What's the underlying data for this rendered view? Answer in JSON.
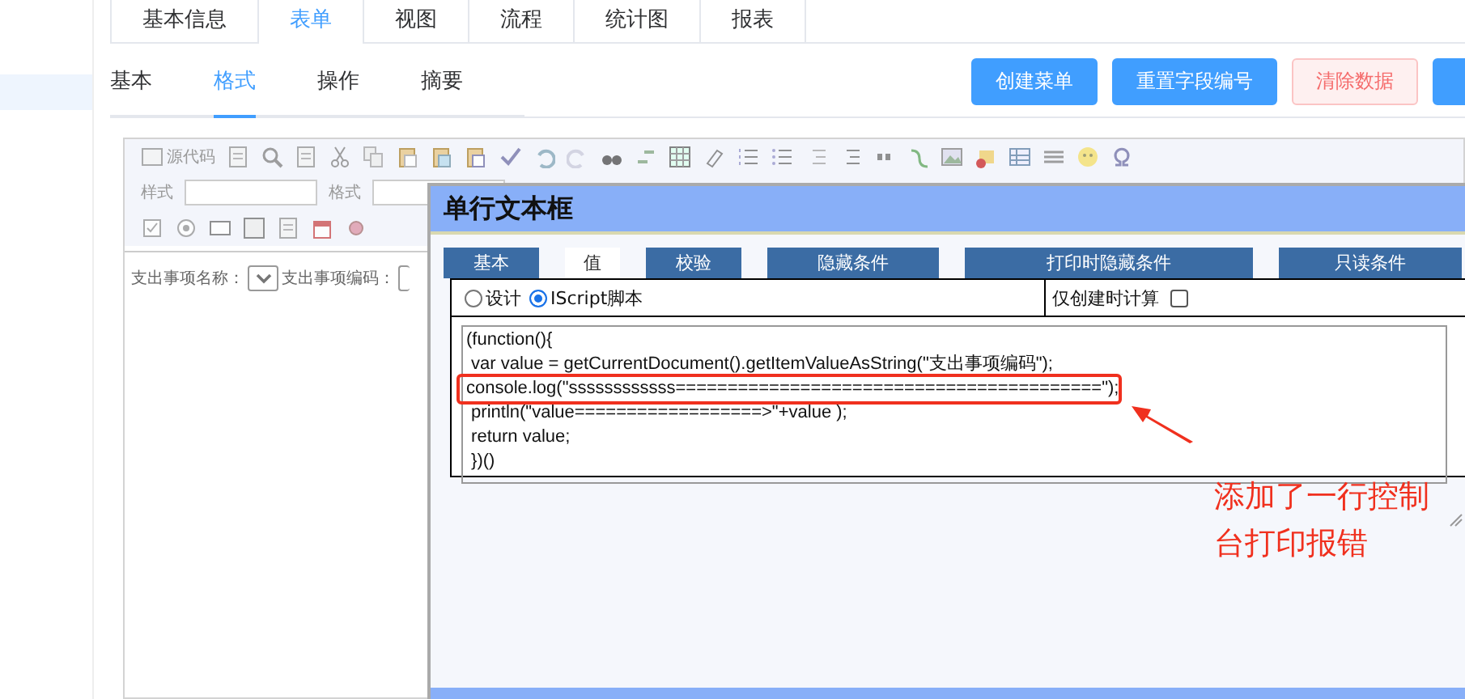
{
  "top_tabs": [
    {
      "label": "基本信息",
      "selected": false
    },
    {
      "label": "表单",
      "selected": true
    },
    {
      "label": "视图",
      "selected": false
    },
    {
      "label": "流程",
      "selected": false
    },
    {
      "label": "统计图",
      "selected": false
    },
    {
      "label": "报表",
      "selected": false
    }
  ],
  "sub_tabs": [
    {
      "label": "基本",
      "selected": false
    },
    {
      "label": "格式",
      "selected": true
    },
    {
      "label": "操作",
      "selected": false
    },
    {
      "label": "摘要",
      "selected": false
    }
  ],
  "actions": [
    {
      "label": "创建菜单",
      "kind": "primary"
    },
    {
      "label": "重置字段编号",
      "kind": "primary"
    },
    {
      "label": "清除数据",
      "kind": "danger"
    },
    {
      "kind": "primary"
    }
  ],
  "editor": {
    "source_label": "源代码",
    "style_label": "样式",
    "format_label": "格式",
    "form_fields": [
      {
        "label": "支出事项名称："
      },
      {
        "label": "支出事项编码："
      }
    ]
  },
  "dialog": {
    "title": "单行文本框",
    "tabs": [
      {
        "label": "基本",
        "selected": false
      },
      {
        "label": "值",
        "selected": true
      },
      {
        "label": "校验",
        "selected": false
      },
      {
        "label": "隐藏条件",
        "selected": false
      },
      {
        "label": "打印时隐藏条件",
        "selected": false
      },
      {
        "label": "只读条件",
        "selected": false
      }
    ],
    "value_modes": [
      {
        "label": "设计",
        "selected": false
      },
      {
        "label": "IScript脚本",
        "selected": true
      }
    ],
    "create_only": {
      "label": "仅创建时计算",
      "checked": false
    },
    "script_lines": [
      "(function(){",
      " var value = getCurrentDocument().getItemValueAsString(\"支出事项编码\");",
      "console.log(\"ssssssssssss=========================================\");",
      " println(\"value==================>\"+value );",
      " return value;",
      " })()"
    ]
  },
  "annotation": {
    "text": "添加了一行控制台打印报错"
  }
}
